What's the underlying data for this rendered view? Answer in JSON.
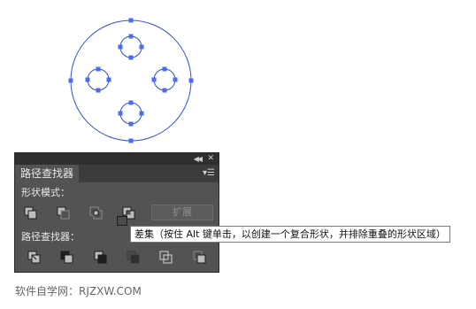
{
  "pathfinder_panel": {
    "title": "路径查找器",
    "shape_modes_label": "形状模式：",
    "shape_modes": [
      {
        "icon": "unite-icon",
        "name": "unite"
      },
      {
        "icon": "minus-front-icon",
        "name": "minus-front"
      },
      {
        "icon": "intersect-icon",
        "name": "intersect"
      },
      {
        "icon": "exclude-icon",
        "name": "exclude"
      }
    ],
    "expand_label": "扩展",
    "pathfinders_label": "路径查找器：",
    "pathfinders": [
      {
        "icon": "divide-icon",
        "name": "divide"
      },
      {
        "icon": "trim-icon",
        "name": "trim"
      },
      {
        "icon": "merge-icon",
        "name": "merge"
      },
      {
        "icon": "crop-icon",
        "name": "crop"
      },
      {
        "icon": "outline-icon",
        "name": "outline"
      },
      {
        "icon": "minus-back-icon",
        "name": "minus-back"
      }
    ]
  },
  "tooltip": "差集（按住 Alt 键单击，以创建一个复合形状，并排除重叠的形状区域）",
  "watermark": "软件自学网：RJZXW.COM",
  "colors": {
    "path_blue": "#2f4fd8",
    "anchor_blue": "#4a6df0",
    "panel_bg": "#535353",
    "panel_tabrow": "#3c3c3c"
  }
}
